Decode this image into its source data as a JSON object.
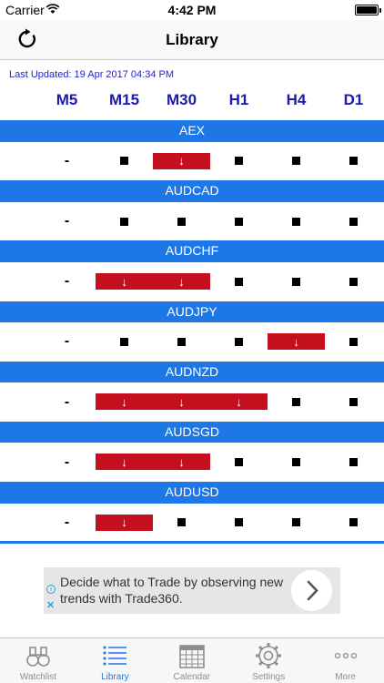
{
  "status_bar": {
    "carrier": "Carrier",
    "time": "4:42 PM"
  },
  "nav": {
    "title": "Library",
    "refresh_icon": "refresh-icon"
  },
  "last_updated": "Last Updated: 19 Apr 2017 04:34 PM",
  "timeframes": [
    "M5",
    "M15",
    "M30",
    "H1",
    "H4",
    "D1"
  ],
  "pairs": [
    {
      "name": "AEX",
      "cells": [
        "-",
        "flat",
        "down",
        "flat",
        "flat",
        "flat"
      ]
    },
    {
      "name": "AUDCAD",
      "cells": [
        "-",
        "flat",
        "flat",
        "flat",
        "flat",
        "flat"
      ]
    },
    {
      "name": "AUDCHF",
      "cells": [
        "-",
        "down",
        "down",
        "flat",
        "flat",
        "flat"
      ]
    },
    {
      "name": "AUDJPY",
      "cells": [
        "-",
        "flat",
        "flat",
        "flat",
        "down",
        "flat"
      ]
    },
    {
      "name": "AUDNZD",
      "cells": [
        "-",
        "down",
        "down",
        "down",
        "flat",
        "flat"
      ]
    },
    {
      "name": "AUDSGD",
      "cells": [
        "-",
        "down",
        "down",
        "flat",
        "flat",
        "flat"
      ]
    },
    {
      "name": "AUDUSD",
      "cells": [
        "-",
        "down",
        "flat",
        "flat",
        "flat",
        "flat"
      ]
    }
  ],
  "symbols": {
    "dash": "-",
    "down_arrow": "↓"
  },
  "ad": {
    "text": "Decide what to Trade by observing new trends with Trade360.",
    "info_glyph": "i",
    "close_glyph": "✕"
  },
  "tabs": [
    {
      "label": "Watchlist",
      "icon": "binoculars-icon",
      "active": false
    },
    {
      "label": "Library",
      "icon": "list-icon",
      "active": true
    },
    {
      "label": "Calendar",
      "icon": "calendar-icon",
      "active": false
    },
    {
      "label": "Settings",
      "icon": "gear-icon",
      "active": false
    },
    {
      "label": "More",
      "icon": "more-icon",
      "active": false
    }
  ],
  "colors": {
    "accent": "#1d77e6",
    "down": "#c4101e",
    "header_text": "#1a1ab0",
    "updated_text": "#2222cc"
  }
}
